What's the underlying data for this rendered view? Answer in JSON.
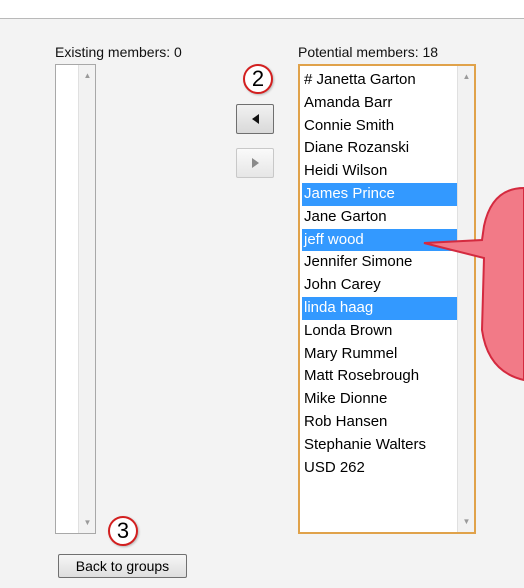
{
  "existing": {
    "label": "Existing members: 0",
    "items": []
  },
  "potential": {
    "label": "Potential members: 18",
    "items": [
      {
        "text": "# Janetta Garton",
        "selected": false
      },
      {
        "text": "Amanda Barr",
        "selected": false
      },
      {
        "text": "Connie Smith",
        "selected": false
      },
      {
        "text": "Diane Rozanski",
        "selected": false
      },
      {
        "text": "Heidi Wilson",
        "selected": false
      },
      {
        "text": "James Prince",
        "selected": true
      },
      {
        "text": "Jane Garton",
        "selected": false
      },
      {
        "text": "jeff wood",
        "selected": true
      },
      {
        "text": "Jennifer Simone",
        "selected": false
      },
      {
        "text": "John Carey",
        "selected": false
      },
      {
        "text": "linda haag",
        "selected": true
      },
      {
        "text": "Londa Brown",
        "selected": false
      },
      {
        "text": "Mary Rummel",
        "selected": false
      },
      {
        "text": "Matt Rosebrough",
        "selected": false
      },
      {
        "text": "Mike Dionne",
        "selected": false
      },
      {
        "text": "Rob Hansen",
        "selected": false
      },
      {
        "text": "Stephanie Walters",
        "selected": false
      },
      {
        "text": "USD 262",
        "selected": false
      }
    ]
  },
  "buttons": {
    "move_left_icon": "triangle-left-icon",
    "move_right_icon": "triangle-right-icon",
    "back_label": "Back to groups"
  },
  "callouts": {
    "step_2": "2",
    "step_3": "3"
  },
  "colors": {
    "selection": "#3399ff",
    "callout_red": "#e8394f",
    "highlight_border": "#e0a24a"
  }
}
